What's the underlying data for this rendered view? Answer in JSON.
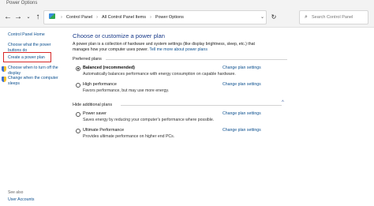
{
  "window": {
    "title": "Power Options"
  },
  "address_bar": {
    "crumbs": [
      "Control Panel",
      "All Control Panel Items",
      "Power Options"
    ],
    "search_placeholder": "Search Control Panel"
  },
  "sidebar": {
    "home": "Control Panel Home",
    "links": [
      "Choose what the power buttons do",
      "Create a power plan",
      "Choose when to turn off the display",
      "Change when the computer sleeps"
    ],
    "see_also": "See also",
    "user_accounts": "User Accounts"
  },
  "main": {
    "heading": "Choose or customize a power plan",
    "intro_text": "A power plan is a collection of hardware and system settings (like display brightness, sleep, etc.) that manages how your computer uses power.",
    "intro_link": "Tell me more about power plans",
    "preferred_label": "Preferred plans",
    "hidden_label": "Hide additional plans",
    "change_link": "Change plan settings",
    "plans": [
      {
        "name": "Balanced (recommended)",
        "desc": "Automatically balances performance with energy consumption on capable hardware.",
        "selected": true
      },
      {
        "name": "High performance",
        "desc": "Favors performance, but may use more energy.",
        "selected": false
      },
      {
        "name": "Power saver",
        "desc": "Saves energy by reducing your computer's performance where possible.",
        "selected": false
      },
      {
        "name": "Ultimate Performance",
        "desc": "Provides ultimate performance on higher end PCs.",
        "selected": false
      }
    ]
  }
}
